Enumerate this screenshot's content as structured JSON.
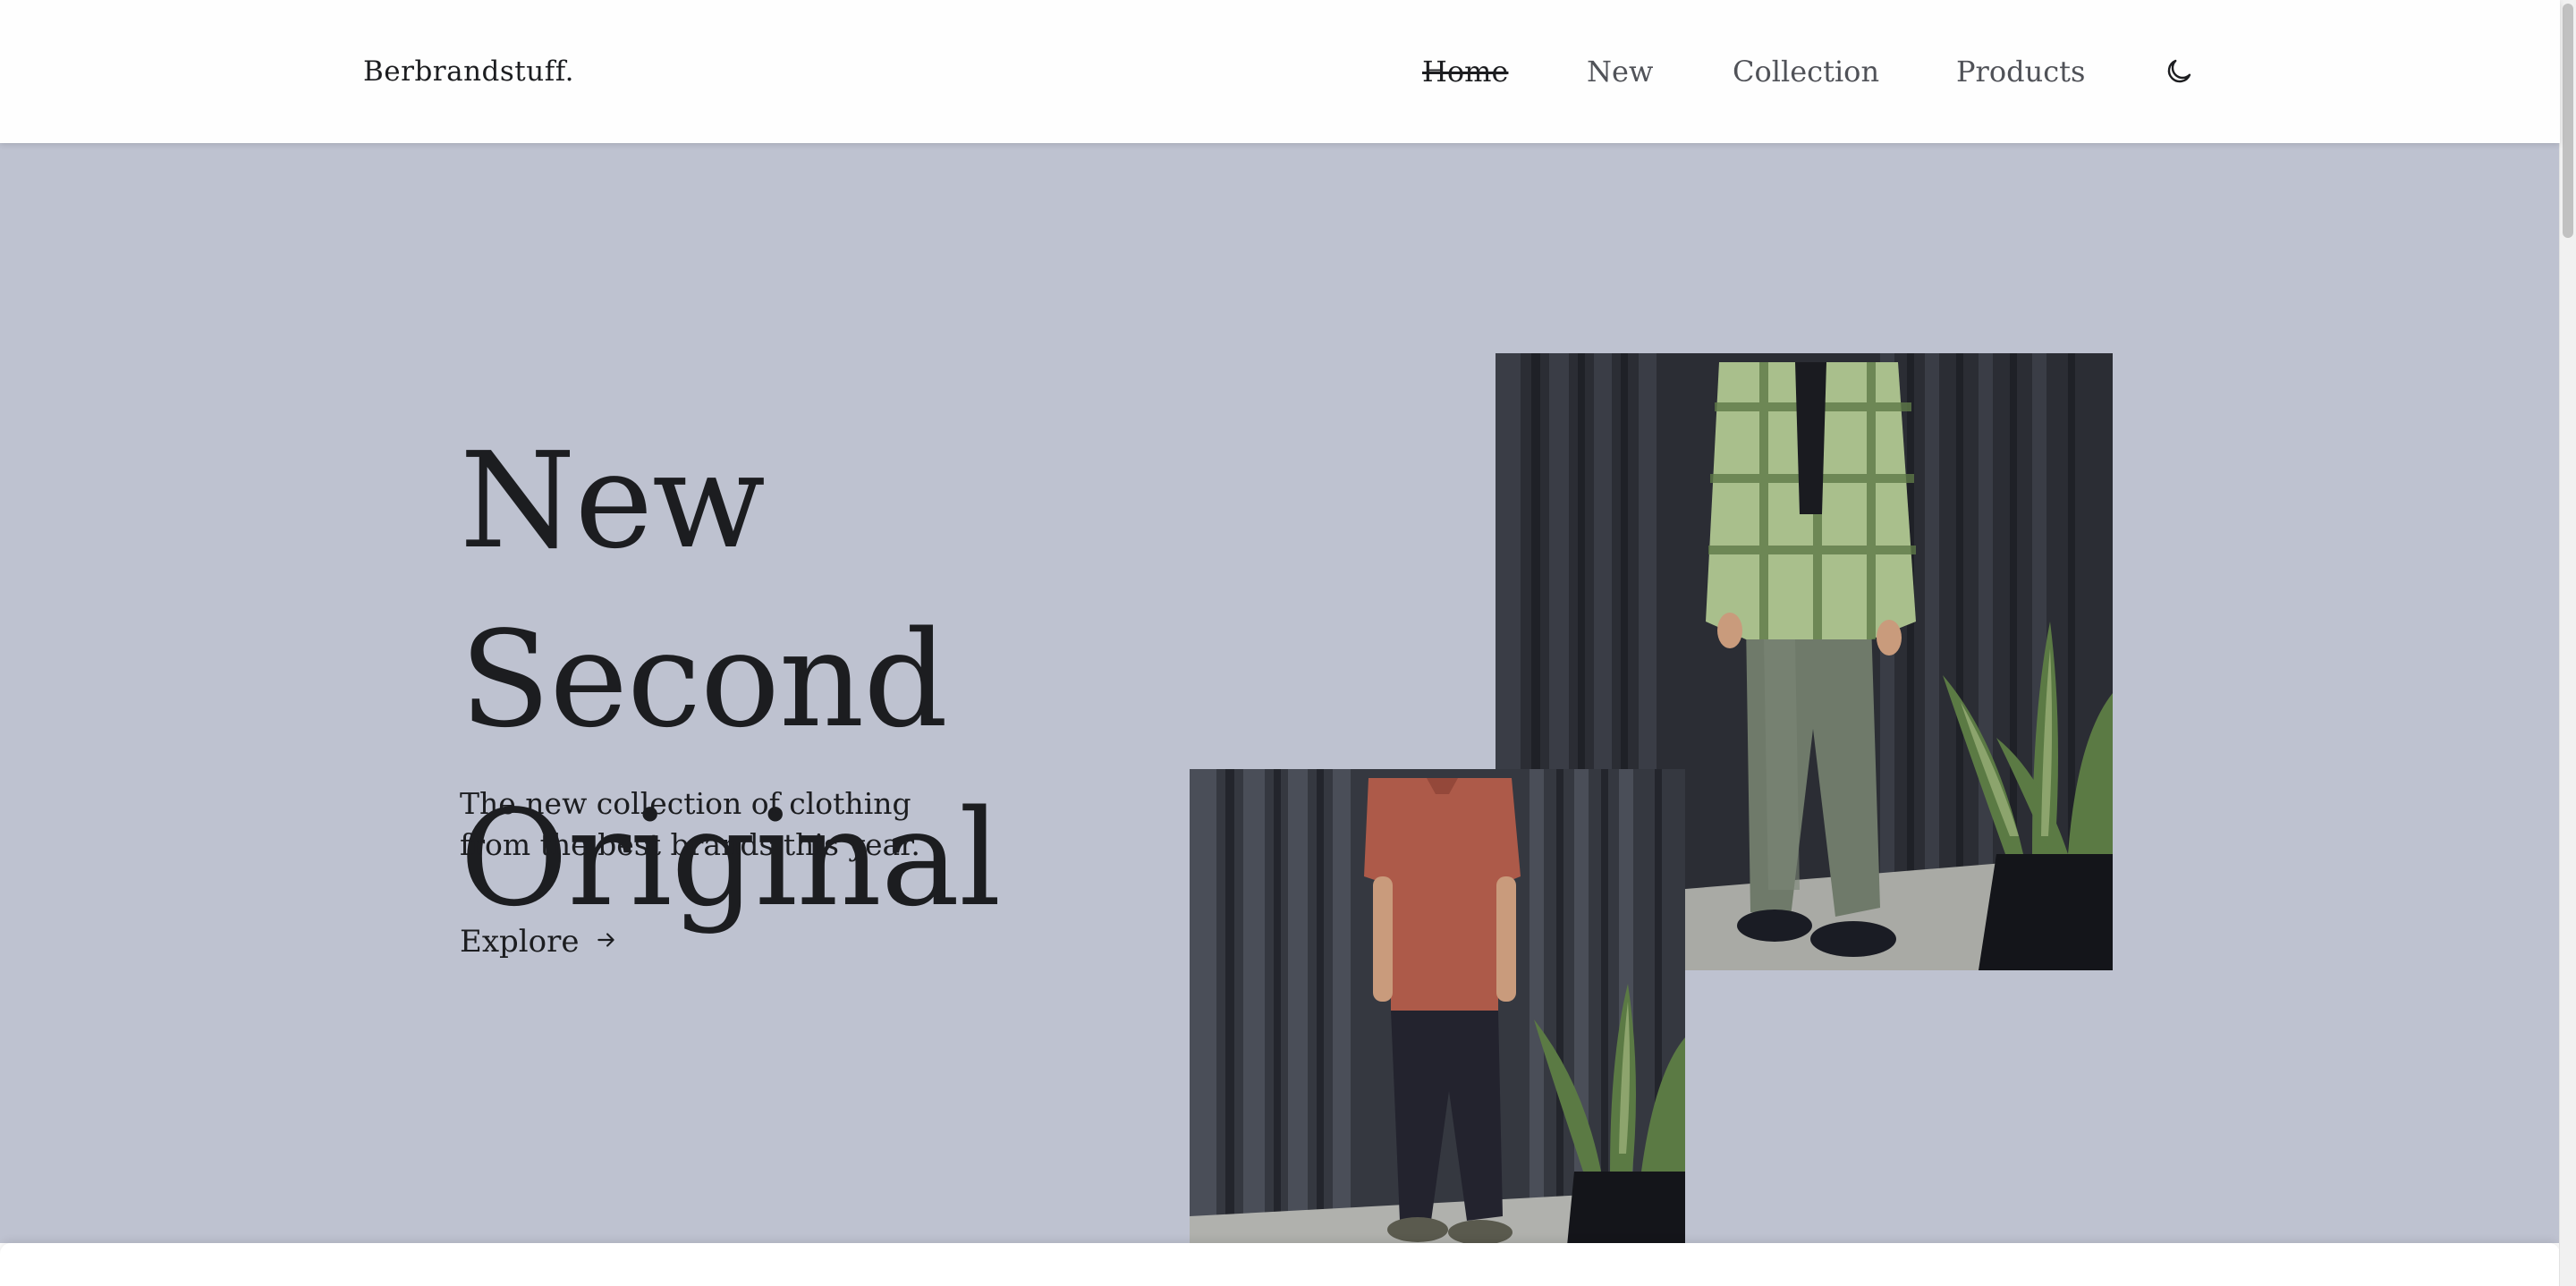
{
  "header": {
    "logo": "Berbrandstuff.",
    "nav": [
      {
        "label": "Home",
        "active": true
      },
      {
        "label": "New",
        "active": false
      },
      {
        "label": "Collection",
        "active": false
      },
      {
        "label": "Products",
        "active": false
      }
    ],
    "theme_toggle_icon": "moon-icon"
  },
  "hero": {
    "title_line1": "New Second",
    "title_line2": "Original",
    "subtitle": "The new collection of clothing from the best brands this year.",
    "cta_label": "Explore",
    "cta_icon": "arrow-right-icon",
    "background_color": "#bec2d0",
    "images": [
      {
        "name": "plaid-shirt-cargo-pants-photo"
      },
      {
        "name": "red-tshirt-black-pants-photo"
      }
    ]
  }
}
